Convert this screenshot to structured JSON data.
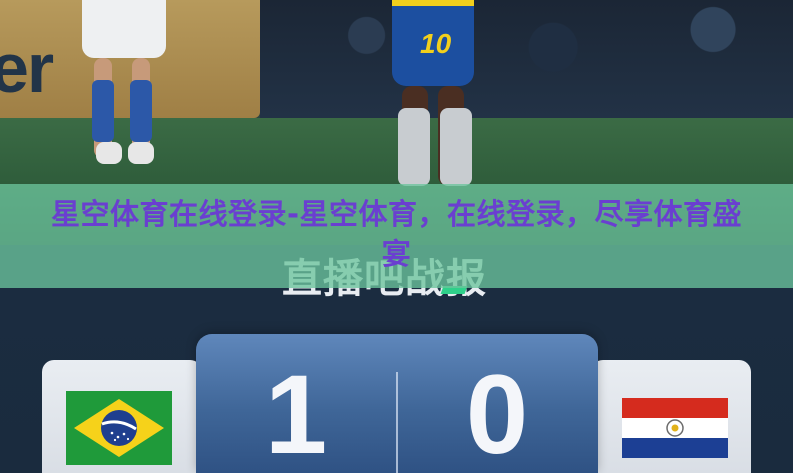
{
  "banner": {
    "title": "星空体育在线登录-星空体育，在线登录，尽享体育盛宴"
  },
  "photo": {
    "ad_board_text": "er",
    "jersey_number": "10"
  },
  "brand": {
    "logo_text": "直播吧战报"
  },
  "match": {
    "home_team_flag": "brazil-flag-icon",
    "away_team_flag": "paraguay-flag-icon",
    "home_score": "1",
    "away_score": "0"
  },
  "colors": {
    "banner_bg": "#6cc49c",
    "banner_text": "#6a3fd0",
    "score_panel": "#3f6698",
    "page_bg": "#1a2b3f"
  }
}
